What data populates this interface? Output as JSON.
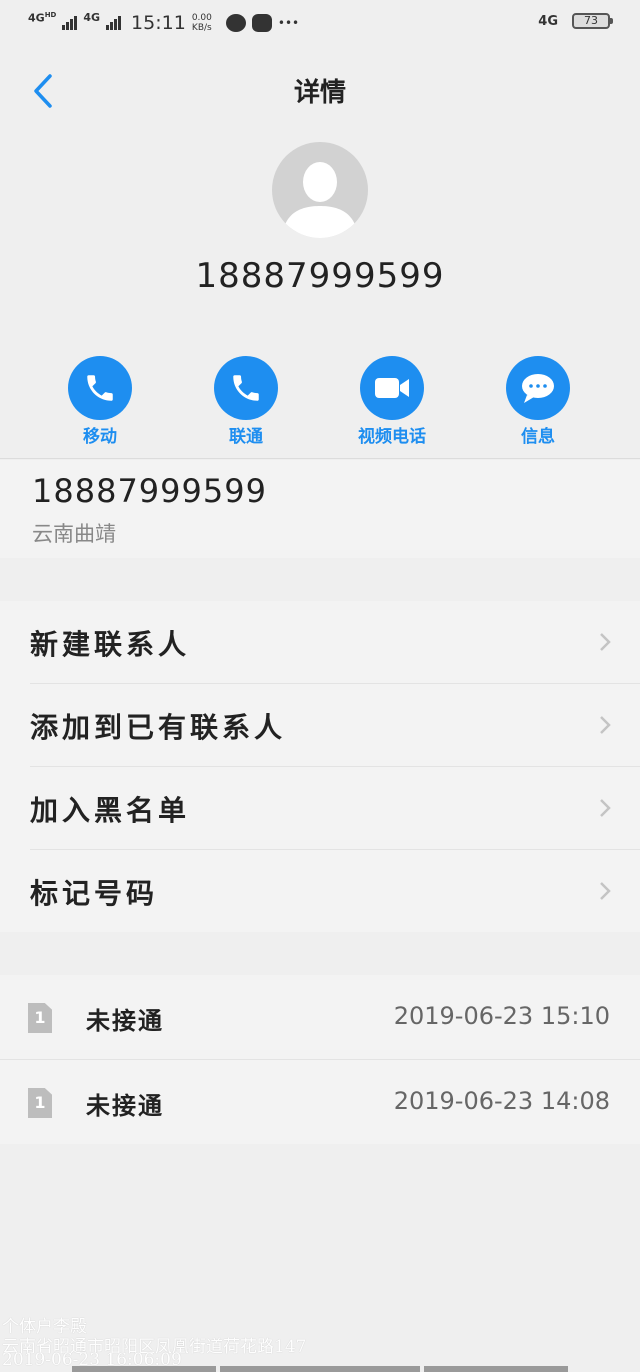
{
  "status_bar": {
    "net1": "4G",
    "net1_sup": "HD",
    "net2": "4G",
    "time": "15:11",
    "speed_value": "0.00",
    "speed_unit": "KB/s",
    "more": "•••",
    "right_net": "4G",
    "battery": "73"
  },
  "header": {
    "title": "详情"
  },
  "contact": {
    "number": "18887999599"
  },
  "actions": [
    {
      "label": "移动",
      "icon": "phone-icon"
    },
    {
      "label": "联通",
      "icon": "phone-icon"
    },
    {
      "label": "视频电话",
      "icon": "video-camera-icon"
    },
    {
      "label": "信息",
      "icon": "message-bubble-icon"
    }
  ],
  "number_info": {
    "number": "18887999599",
    "region": "云南曲靖"
  },
  "menu": [
    {
      "label": "新建联系人"
    },
    {
      "label": "添加到已有联系人"
    },
    {
      "label": "加入黑名单"
    },
    {
      "label": "标记号码"
    }
  ],
  "calls": [
    {
      "sim": "1",
      "status": "未接通",
      "time": "2019-06-23 15:10"
    },
    {
      "sim": "1",
      "status": "未接通",
      "time": "2019-06-23 14:08"
    }
  ],
  "watermark": {
    "line1": "个体户李殿",
    "line2": "云南省昭通市昭阳区凤凰街道荷花路147",
    "line3": "2019-06-23 16:06:09"
  },
  "colors": {
    "accent": "#1e8ef0",
    "background": "#efefef",
    "card": "#f3f3f3"
  }
}
